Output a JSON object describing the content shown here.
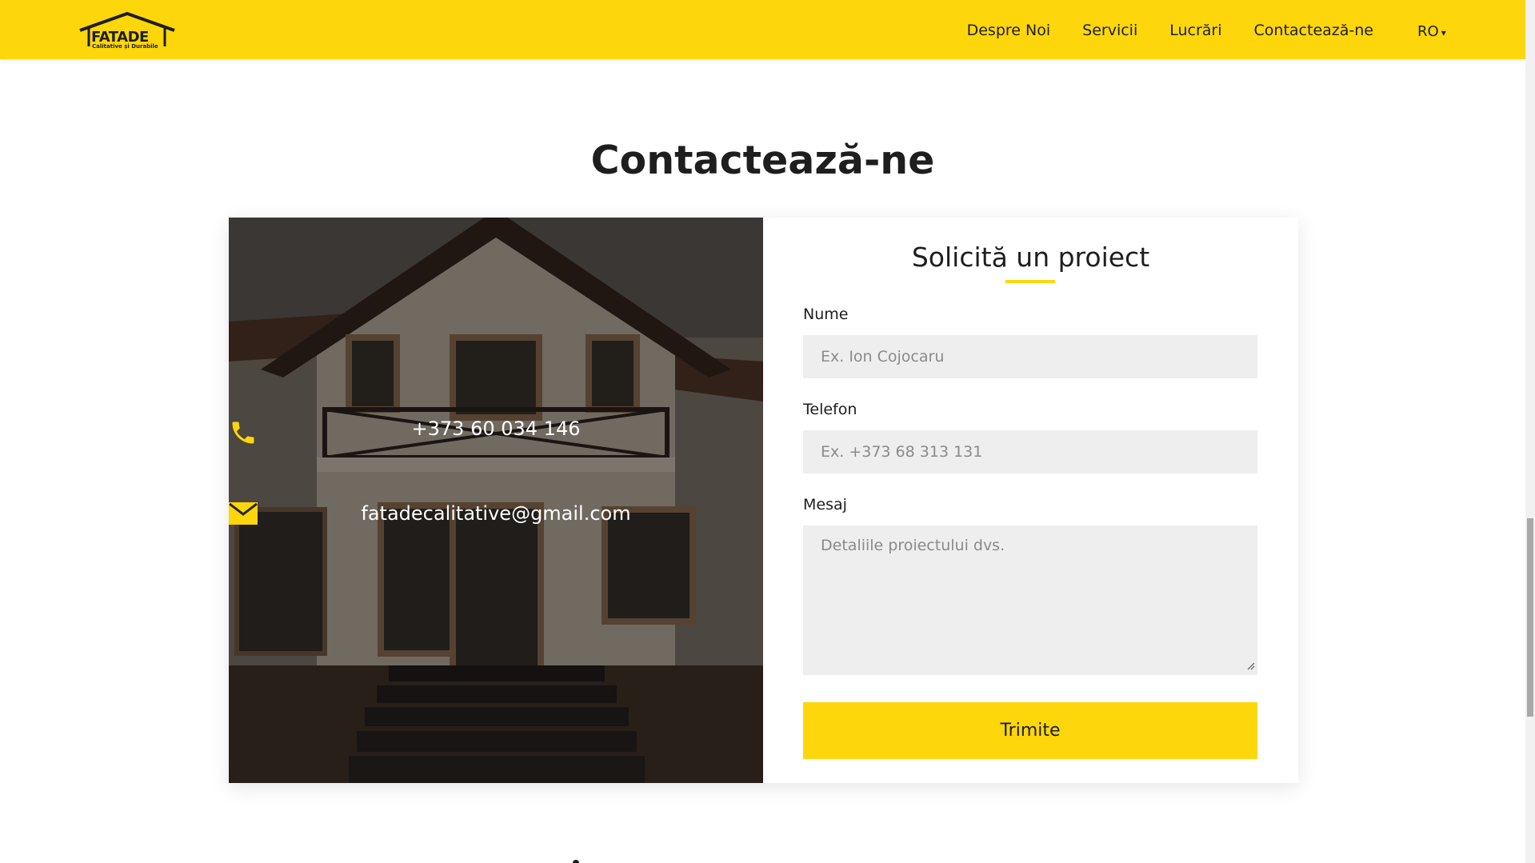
{
  "brand": {
    "name": "FATADE",
    "tagline": "Calitative și Durabile",
    "accent_color": "#fdd70b"
  },
  "nav": {
    "items": [
      {
        "label": "Despre Noi"
      },
      {
        "label": "Servicii"
      },
      {
        "label": "Lucrări"
      },
      {
        "label": "Contactează-ne"
      }
    ],
    "language": "RO",
    "language_caret": "▾"
  },
  "section": {
    "title": "Contactează-ne"
  },
  "contact": {
    "phone": "+373 60 034 146",
    "email": "fatadecalitative@gmail.com",
    "phone_icon": "phone-icon",
    "email_icon": "envelope-icon"
  },
  "form": {
    "title": "Solicită un proiect",
    "name_label": "Nume",
    "name_placeholder": "Ex. Ion Cojocaru",
    "phone_label": "Telefon",
    "phone_placeholder": "Ex. +373 68 313 131",
    "message_label": "Mesaj",
    "message_placeholder": "Detaliile proiectului dvs.",
    "submit_label": "Trimite"
  }
}
